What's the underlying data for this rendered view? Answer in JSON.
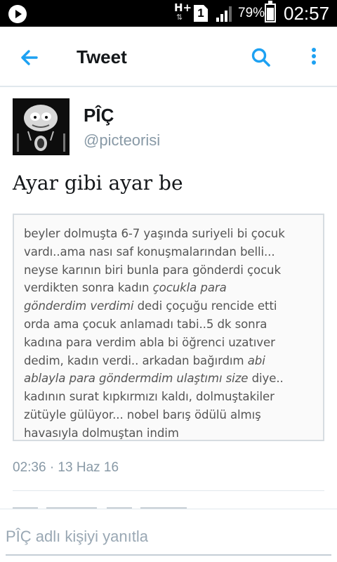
{
  "status_bar": {
    "network": "H+",
    "sim": "1",
    "battery_percent": "79%",
    "battery_level": 0.79,
    "time": "02:57"
  },
  "header": {
    "title": "Tweet",
    "back_icon": "arrow-left-icon",
    "search_icon": "search-icon",
    "more_icon": "more-vertical-icon",
    "accent_color": "#1da1f2"
  },
  "tweet": {
    "user_name": "PÎÇ",
    "user_handle": "@picteorisi",
    "text": "Ayar gibi ayar be",
    "media_lines": [
      {
        "parts": [
          {
            "t": "beyler dolmuşta 6-7 yaşında suriyeli bi çocuk",
            "i": false
          }
        ]
      },
      {
        "parts": [
          {
            "t": "vardı..ama nası saf konuşmalarından belli...",
            "i": false
          }
        ]
      },
      {
        "parts": [
          {
            "t": "neyse karının biri bunla para gönderdi çocuk",
            "i": false
          }
        ]
      },
      {
        "parts": [
          {
            "t": "verdikten sonra kadın ",
            "i": false
          },
          {
            "t": "çocukla para",
            "i": true
          }
        ]
      },
      {
        "parts": [
          {
            "t": "gönderdim verdimi",
            "i": true
          },
          {
            "t": " dedi çoçuğu rencide etti",
            "i": false
          }
        ]
      },
      {
        "parts": [
          {
            "t": "orda ama çocuk anlamadı tabi..5 dk sonra",
            "i": false
          }
        ]
      },
      {
        "parts": [
          {
            "t": "kadına para verdim abla bi öğrenci uzatıver",
            "i": false
          }
        ]
      },
      {
        "parts": [
          {
            "t": "dedim, kadın verdi.. arkadan bağırdım ",
            "i": false
          },
          {
            "t": "abi",
            "i": true
          }
        ]
      },
      {
        "parts": [
          {
            "t": "ablayla para göndermdim ulaştımı size",
            "i": true
          },
          {
            "t": " diye..",
            "i": false
          }
        ]
      },
      {
        "parts": [
          {
            "t": "kadının surat kıpkırmızı kaldı, dolmuştakiler",
            "i": false
          }
        ]
      },
      {
        "parts": [
          {
            "t": "zütüyle gülüyor... nobel barış ödülü almış",
            "i": false
          }
        ]
      },
      {
        "parts": [
          {
            "t": "havasıyla dolmuştan indim",
            "i": false
          }
        ]
      }
    ],
    "timestamp": "02:36 · 13 Haz 16"
  },
  "reply": {
    "placeholder": "PÎÇ adlı kişiyi yanıtla"
  }
}
